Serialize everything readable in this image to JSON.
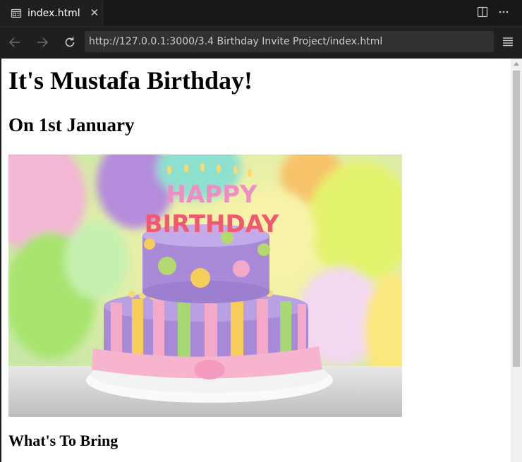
{
  "tab": {
    "title": "index.html",
    "close": "✕"
  },
  "nav": {
    "url": "http://127.0.0.1:3000/3.4 Birthday Invite Project/index.html"
  },
  "page": {
    "heading": "It's Mustafa Birthday!",
    "date_heading": "On 1st January",
    "image_text_line1": "HAPPY",
    "image_text_line2": "BIRTHDAY",
    "bring_heading": "What's To Bring"
  },
  "colors": {
    "chrome": "#1f1f1f",
    "tabstrip": "#181818",
    "urlbox": "#313131"
  }
}
